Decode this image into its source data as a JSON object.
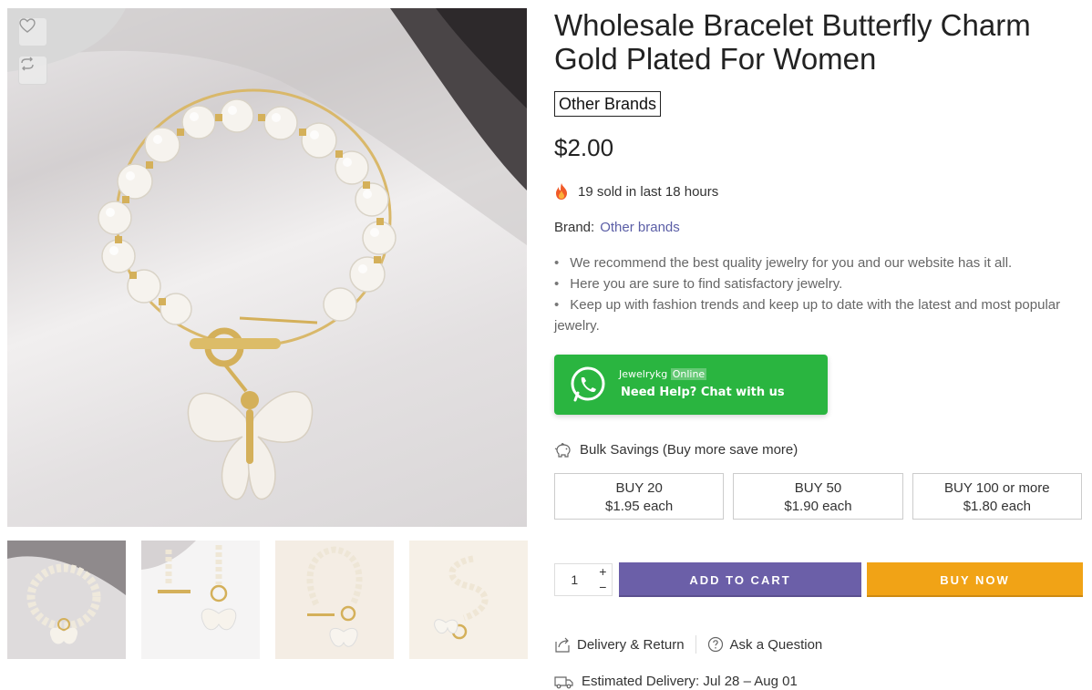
{
  "product": {
    "title": "Wholesale Bracelet Butterfly Charm Gold Plated For Women",
    "brand_tag": "Other Brands",
    "price": "$2.00",
    "sold_text": "19 sold in last 18 hours",
    "brand_label": "Brand:",
    "brand_link": "Other brands",
    "bullets": [
      "We recommend the best quality jewelry for you and our website has it all.",
      "Here you are sure to find satisfactory jewelry.",
      "Keep up with fashion trends and keep up to date with the latest and most popular jewelry."
    ]
  },
  "gallery": {
    "wishlist_icon": "heart-icon",
    "compare_icon": "compare-arrows-icon",
    "thumbnails_count": 4
  },
  "whatsapp": {
    "name": "Jewelrykg",
    "status": "Online",
    "cta": "Need Help? Chat with us",
    "color": "#2ab540"
  },
  "bulk": {
    "title": "Bulk Savings (Buy more save more)",
    "tiers": [
      {
        "qty": "BUY 20",
        "price": "$1.95 each"
      },
      {
        "qty": "BUY 50",
        "price": "$1.90 each"
      },
      {
        "qty": "BUY 100 or more",
        "price": "$1.80 each"
      }
    ]
  },
  "purchase": {
    "quantity": "1",
    "plus": "+",
    "minus": "−",
    "add_to_cart": "ADD TO CART",
    "buy_now": "BUY NOW",
    "cart_color": "#6b5fa8",
    "buy_color": "#f1a316"
  },
  "footer_links": {
    "delivery_return": "Delivery & Return",
    "ask_question": "Ask a Question",
    "estimated_delivery": "Estimated Delivery: Jul 28 – Aug 01"
  }
}
